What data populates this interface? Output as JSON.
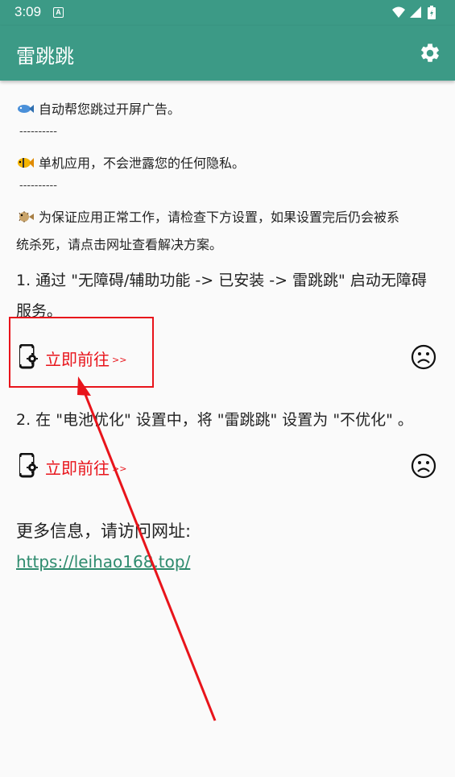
{
  "status_bar": {
    "time": "3:09",
    "a_label": "A",
    "icons": [
      "wifi-icon",
      "signal-icon",
      "battery-icon"
    ]
  },
  "app_bar": {
    "title": "雷跳跳",
    "settings_icon": "gear-icon"
  },
  "intro": {
    "line1": "自动帮您跳过开屏广告。",
    "divider1": "----------",
    "line2": "单机应用，不会泄露您的任何隐私。",
    "divider2": "----------",
    "line3a": "为保证应用正常工作，请检查下方设置，如果设置完后仍会被系",
    "line3b": "统杀死，请点击网址查看解决方案。",
    "emojis": [
      "fish",
      "tropical-fish",
      "blowfish"
    ]
  },
  "steps": [
    {
      "text": "1. 通过 \"无障碍/辅助功能 -> 已安装 -> 雷跳跳\" 启动无障碍服务。",
      "text_line1": "1. 通过 \"无障碍/辅助功能 -> 已安装 -> 雷跳跳\" 启动无障碍",
      "text_line2": "服务。",
      "action_label": "立即前往",
      "action_arrows": ">>",
      "status_icon": "sad-face-icon"
    },
    {
      "text": "2. 在 \"电池优化\" 设置中，将 \"雷跳跳\" 设置为 \"不优化\" 。",
      "action_label": "立即前往",
      "action_arrows": ">>",
      "status_icon": "sad-face-icon"
    }
  ],
  "more_info": {
    "label": "更多信息，请访问网址:",
    "url": "https://leihao168.top/"
  },
  "colors": {
    "primary": "#3c9a86",
    "action_red": "#e8141b",
    "link": "#2e8b6e",
    "background": "#fafafa"
  }
}
